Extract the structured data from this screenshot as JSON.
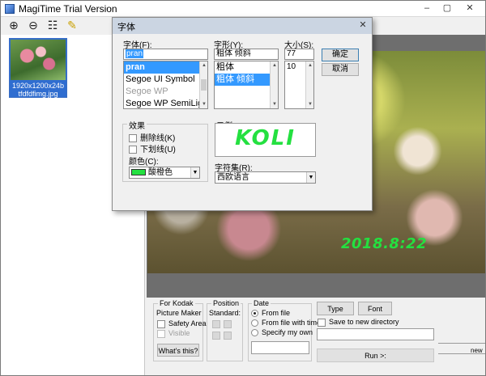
{
  "window": {
    "title": "MagiTime Trial Version",
    "controls": [
      "–",
      "▢",
      "✕"
    ]
  },
  "toolbar": {
    "icons": [
      "add-icon",
      "remove-icon",
      "grid-icon",
      "wand-icon"
    ]
  },
  "sidebar": {
    "thumbnail": {
      "size_label": "1920x1200x24b",
      "file_name": "tfdfdfimg.jpg"
    }
  },
  "photo": {
    "date_stamp": "2018.8:22"
  },
  "bottom": {
    "kodak": {
      "title": "For Kodak",
      "picture_maker": "Picture Maker",
      "safety_area": "Safety Area",
      "visible": "Visible",
      "whats_this": "What's this?"
    },
    "position": {
      "title": "Position",
      "standard": "Standard:"
    },
    "date": {
      "title": "Date",
      "from_file": "From file",
      "from_file_with_time": "From file with time",
      "specify_my_own": "Specify my own"
    },
    "type_btn": "Type",
    "font_btn": "Font",
    "save_new_dir": "Save to new directory",
    "run_btn": "Run >:",
    "new_btn": "new"
  },
  "font_dialog": {
    "title": "字体",
    "font_label": "字体(F):",
    "font_value": "pran",
    "font_list": [
      "pran",
      "Segoe UI Symbol",
      "Segoe WP",
      "Segoe WP SemiLight"
    ],
    "style_label": "字形(Y):",
    "style_value": "粗体 倾斜",
    "style_list": [
      "粗体",
      "粗体 倾斜"
    ],
    "size_label": "大小(S):",
    "size_value": "77",
    "size_list": [
      "10"
    ],
    "ok": "确定",
    "cancel": "取消",
    "effects_title": "效果",
    "strikeout": "删除线(K)",
    "underline": "下划线(U)",
    "color_label": "颜色(C):",
    "color_value": "酸橙色",
    "color_swatch": "#24e040",
    "sample_title": "示例",
    "sample_text": "KOLI",
    "script_label": "字符集(R):",
    "script_value": "西欧语言"
  }
}
